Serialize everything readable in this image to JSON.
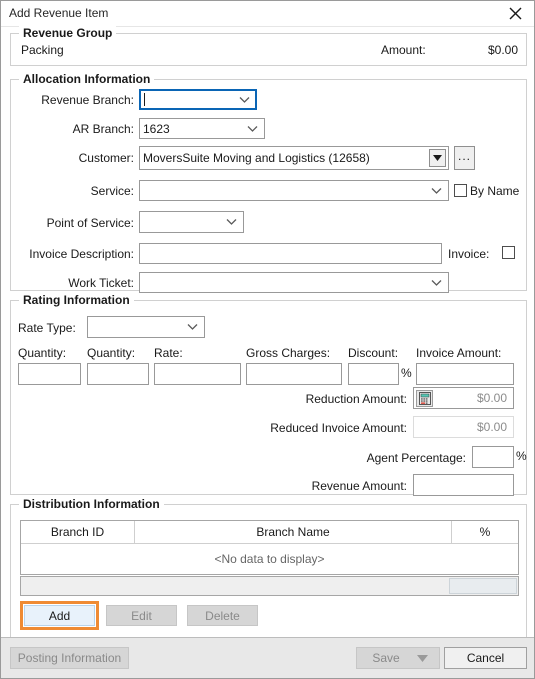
{
  "window": {
    "title": "Add Revenue Item",
    "close_icon": "close-icon"
  },
  "revenue_group": {
    "legend": "Revenue Group",
    "name": "Packing",
    "amount_label": "Amount:",
    "amount_value": "$0.00"
  },
  "allocation": {
    "legend": "Allocation Information",
    "revenue_branch_label": "Revenue Branch:",
    "revenue_branch_value": "",
    "ar_branch_label": "AR Branch:",
    "ar_branch_value": "1623",
    "customer_label": "Customer:",
    "customer_value": "MoversSuite Moving and Logistics (12658)",
    "customer_browse_label": "...",
    "service_label": "Service:",
    "service_value": "",
    "by_name_label": "By Name",
    "point_of_service_label": "Point of Service:",
    "point_of_service_value": "",
    "invoice_description_label": "Invoice Description:",
    "invoice_description_value": "",
    "invoice_label": "Invoice:",
    "work_ticket_label": "Work Ticket:",
    "work_ticket_value": ""
  },
  "rating": {
    "legend": "Rating Information",
    "rate_type_label": "Rate Type:",
    "rate_type_value": "",
    "quantity1_label": "Quantity:",
    "quantity1_value": "",
    "quantity2_label": "Quantity:",
    "quantity2_value": "",
    "rate_label": "Rate:",
    "rate_value": "",
    "gross_charges_label": "Gross Charges:",
    "gross_charges_value": "",
    "discount_label": "Discount:",
    "discount_value": "",
    "discount_pct": "%",
    "invoice_amount_label": "Invoice Amount:",
    "invoice_amount_value": "",
    "reduction_amount_label": "Reduction Amount:",
    "reduction_amount_value": "$0.00",
    "calculator_icon": "calculator-icon",
    "reduced_invoice_amount_label": "Reduced Invoice Amount:",
    "reduced_invoice_amount_value": "$0.00",
    "agent_percentage_label": "Agent Percentage:",
    "agent_percentage_value": "",
    "agent_percentage_pct": "%",
    "revenue_amount_label": "Revenue Amount:",
    "revenue_amount_value": ""
  },
  "distribution": {
    "legend": "Distribution Information",
    "columns": [
      "Branch ID",
      "Branch Name",
      "%"
    ],
    "empty_text": "<No data to display>",
    "add_label": "Add",
    "edit_label": "Edit",
    "delete_label": "Delete"
  },
  "footer": {
    "posting_information_label": "Posting Information",
    "save_label": "Save",
    "save_arrow_icon": "chevron-down-icon",
    "cancel_label": "Cancel"
  },
  "colors": {
    "highlight_ring": "#ef8b33",
    "focus_border": "#0a65b5",
    "footer_bg": "#e8e8e8"
  }
}
